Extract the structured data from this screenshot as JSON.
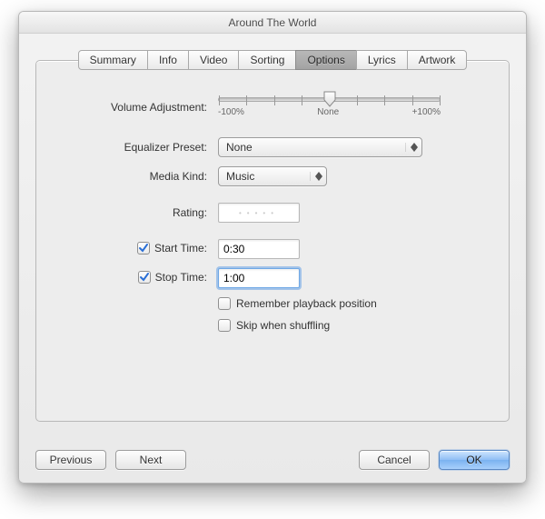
{
  "window": {
    "title": "Around The World"
  },
  "tabs": [
    {
      "label": "Summary",
      "active": false
    },
    {
      "label": "Info",
      "active": false
    },
    {
      "label": "Video",
      "active": false
    },
    {
      "label": "Sorting",
      "active": false
    },
    {
      "label": "Options",
      "active": true
    },
    {
      "label": "Lyrics",
      "active": false
    },
    {
      "label": "Artwork",
      "active": false
    }
  ],
  "options": {
    "volume_adjustment_label": "Volume Adjustment:",
    "volume_slider": {
      "min_label": "-100%",
      "center_label": "None",
      "max_label": "+100%",
      "value_percent": 50
    },
    "equalizer_preset_label": "Equalizer Preset:",
    "equalizer_preset_value": "None",
    "media_kind_label": "Media Kind:",
    "media_kind_value": "Music",
    "rating_label": "Rating:",
    "rating_value": 0,
    "start_time_label": "Start Time:",
    "start_time_checked": true,
    "start_time_value": "0:30",
    "stop_time_label": "Stop Time:",
    "stop_time_checked": true,
    "stop_time_value": "1:00",
    "remember_playback_label": "Remember playback position",
    "remember_playback_checked": false,
    "skip_shuffle_label": "Skip when shuffling",
    "skip_shuffle_checked": false
  },
  "footer": {
    "previous_label": "Previous",
    "next_label": "Next",
    "cancel_label": "Cancel",
    "ok_label": "OK"
  },
  "colors": {
    "focus_ring": "#6fa8e6",
    "default_button_top": "#cfe6ff",
    "default_button_bottom": "#7ab2f0"
  }
}
